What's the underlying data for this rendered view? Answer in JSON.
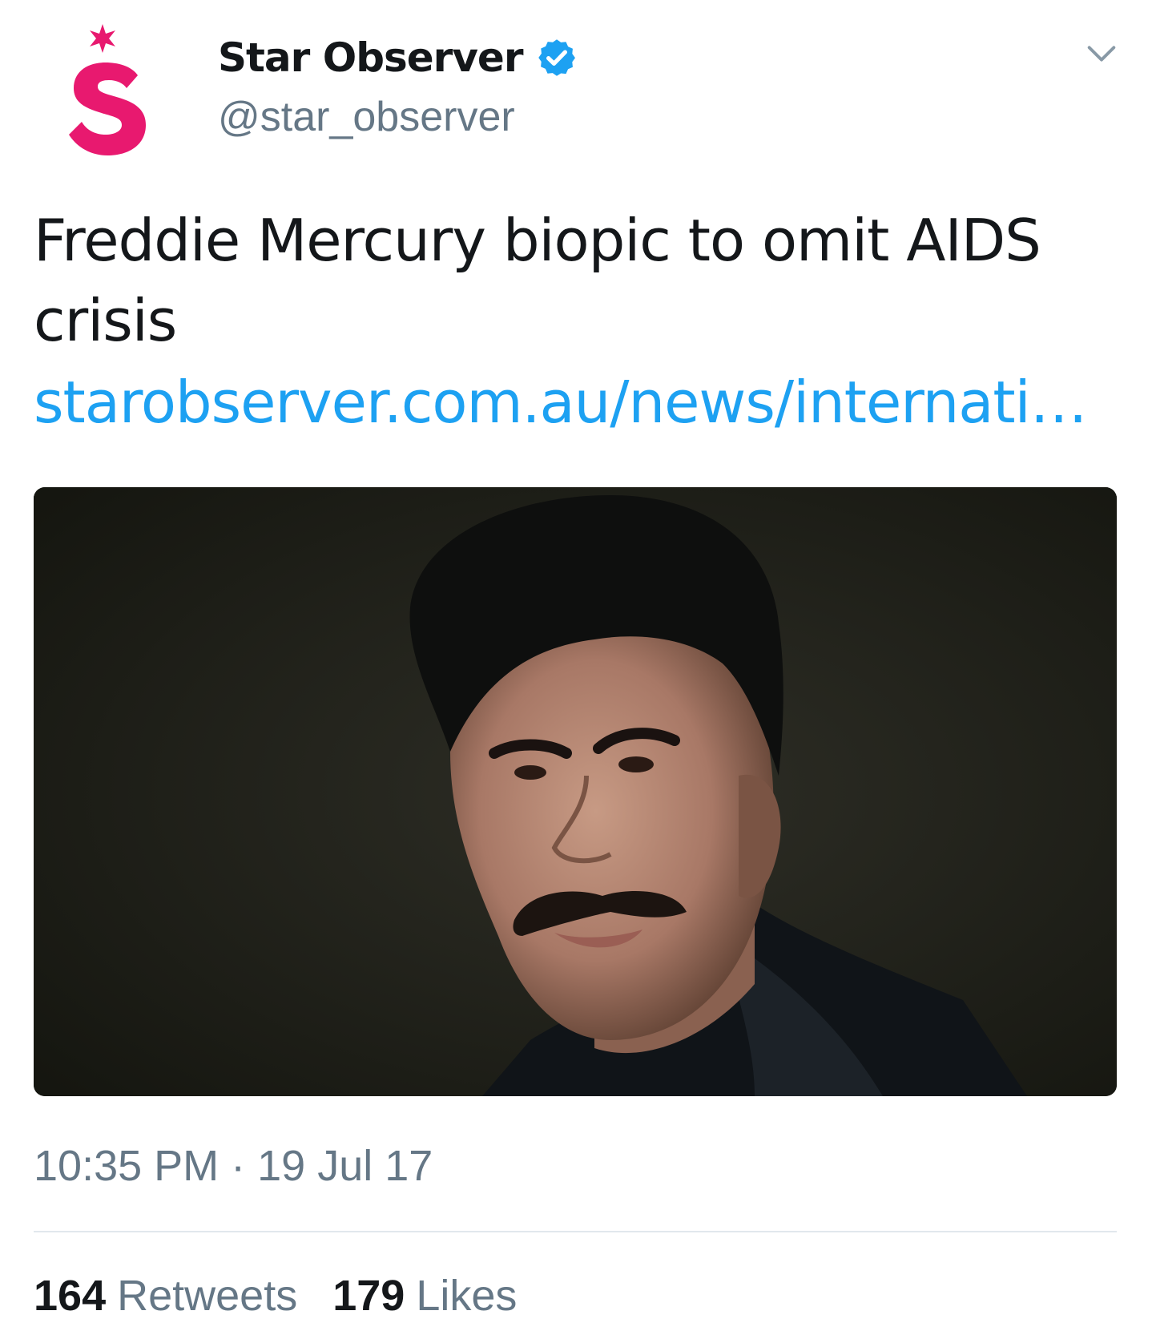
{
  "account": {
    "display_name": "Star Observer",
    "handle": "@star_observer",
    "verified": true,
    "avatar_icon": "star-observer-logo",
    "avatar_letter": "S",
    "brand_color": "#e8196f"
  },
  "tweet": {
    "text": "Freddie Mercury biopic to omit AIDS crisis",
    "link": "starobserver.com.au/news/internati…",
    "media_icon": "portrait-photo",
    "timestamp": "10:35 PM · 19 Jul 17"
  },
  "stats": {
    "retweets_count": "164",
    "retweets_label": "Retweets",
    "likes_count": "179",
    "likes_label": "Likes"
  },
  "icons": {
    "verified": "verified-badge-icon",
    "menu": "chevron-down-icon"
  },
  "colors": {
    "text": "#14171a",
    "secondary": "#657786",
    "link": "#1da1f2",
    "verified": "#1da1f2",
    "divider": "#e1e8ed"
  }
}
